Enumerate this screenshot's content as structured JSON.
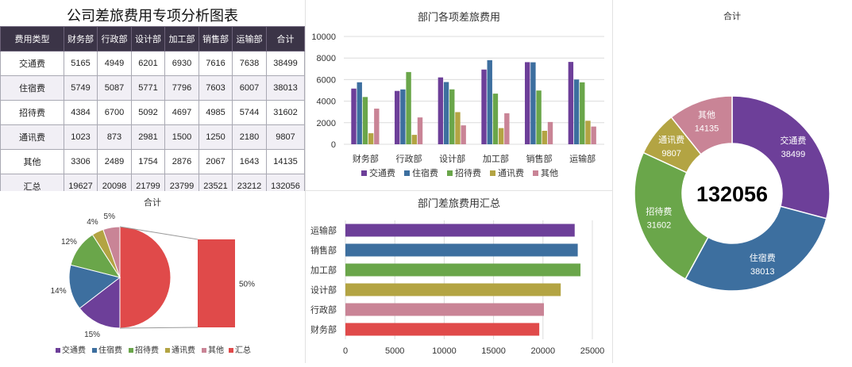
{
  "sheet_title": "公司差旅费用专项分析图表",
  "table": {
    "header": [
      "费用类型",
      "财务部",
      "行政部",
      "设计部",
      "加工部",
      "销售部",
      "运输部",
      "合计"
    ],
    "rows": [
      [
        "交通费",
        "5165",
        "4949",
        "6201",
        "6930",
        "7616",
        "7638",
        "38499"
      ],
      [
        "住宿费",
        "5749",
        "5087",
        "5771",
        "7796",
        "7603",
        "6007",
        "38013"
      ],
      [
        "招待费",
        "4384",
        "6700",
        "5092",
        "4697",
        "4985",
        "5744",
        "31602"
      ],
      [
        "通讯费",
        "1023",
        "873",
        "2981",
        "1500",
        "1250",
        "2180",
        "9807"
      ],
      [
        "其他",
        "3306",
        "2489",
        "1754",
        "2876",
        "2067",
        "1643",
        "14135"
      ],
      [
        "汇总",
        "19627",
        "20098",
        "21799",
        "23799",
        "23521",
        "23212",
        "132056"
      ]
    ]
  },
  "colors": {
    "交通费": "#6d3f99",
    "住宿费": "#3d6f9f",
    "招待费": "#6aa64a",
    "通讯费": "#b3a443",
    "其他": "#c98496",
    "汇总": "#e04a4a"
  },
  "chart_data": [
    {
      "id": "dept-bar",
      "type": "bar",
      "title": "部门各项差旅费用",
      "categories": [
        "财务部",
        "行政部",
        "设计部",
        "加工部",
        "销售部",
        "运输部"
      ],
      "series": [
        {
          "name": "交通费",
          "values": [
            5165,
            4949,
            6201,
            6930,
            7616,
            7638
          ]
        },
        {
          "name": "住宿费",
          "values": [
            5749,
            5087,
            5771,
            7796,
            7603,
            6007
          ]
        },
        {
          "name": "招待费",
          "values": [
            4384,
            6700,
            5092,
            4697,
            4985,
            5744
          ]
        },
        {
          "name": "通讯费",
          "values": [
            1023,
            873,
            2981,
            1500,
            1250,
            2180
          ]
        },
        {
          "name": "其他",
          "values": [
            3306,
            2489,
            1754,
            2876,
            2067,
            1643
          ]
        }
      ],
      "ylim": [
        0,
        10000
      ],
      "yticks": [
        0,
        2000,
        4000,
        6000,
        8000,
        10000
      ],
      "legend": "bottom",
      "grid": true
    },
    {
      "id": "total-donut",
      "type": "pie",
      "title": "合计",
      "categories": [
        "交通费",
        "住宿费",
        "招待费",
        "通讯费",
        "其他"
      ],
      "values": [
        38499,
        38013,
        31602,
        9807,
        14135
      ],
      "center_label": "132056"
    },
    {
      "id": "summary-barh",
      "type": "bar",
      "orientation": "horizontal",
      "title": "部门差旅费用汇总",
      "categories": [
        "运输部",
        "销售部",
        "加工部",
        "设计部",
        "行政部",
        "财务部"
      ],
      "values": [
        23212,
        23521,
        23799,
        21799,
        20098,
        19627
      ],
      "bar_colors": [
        "#6d3f99",
        "#3d6f9f",
        "#6aa64a",
        "#b3a443",
        "#c98496",
        "#e04a4a"
      ],
      "xlim": [
        0,
        25000
      ],
      "xticks": [
        0,
        5000,
        10000,
        15000,
        20000,
        25000
      ],
      "grid": true
    },
    {
      "id": "bar-of-pie",
      "type": "pie",
      "title": "合计",
      "categories": [
        "交通费",
        "住宿费",
        "招待费",
        "通讯费",
        "其他",
        "汇总"
      ],
      "values": [
        38499,
        38013,
        31602,
        9807,
        14135,
        132056
      ],
      "percent_labels": [
        "15%",
        "14%",
        "12%",
        "4%",
        "5%",
        "50%"
      ],
      "split_category": "汇总",
      "legend": "bottom"
    }
  ]
}
